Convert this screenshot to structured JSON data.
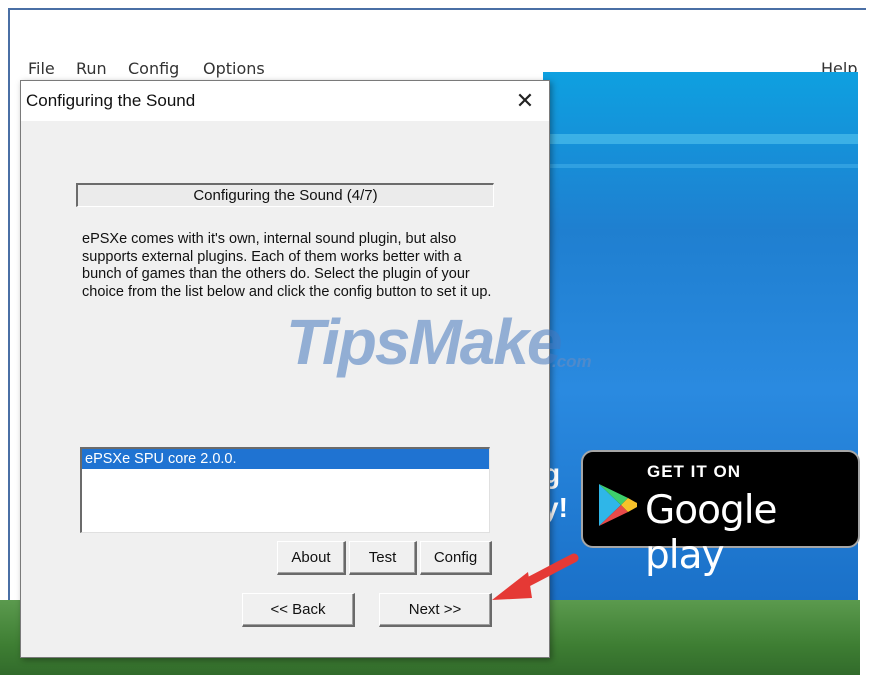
{
  "menubar": {
    "items": [
      "File",
      "Run",
      "Config",
      "Options"
    ],
    "help": "Help"
  },
  "background": {
    "partial_text_line1": "g",
    "partial_text_line2": "y!",
    "google_play": {
      "top": "GET IT ON",
      "main": "Google play"
    }
  },
  "dialog": {
    "title": "Configuring the Sound",
    "close": "✕",
    "step_header": "Configuring the Sound (4/7)",
    "description": "ePSXe comes with it's own, internal sound plugin, but also supports external plugins. Each of them works better with a bunch of games than the others do. Select the plugin of your choice from the list below and click the config button to set it up.",
    "plugins": [
      "ePSXe SPU core 2.0.0."
    ],
    "buttons": {
      "about": "About",
      "test": "Test",
      "config": "Config",
      "back": "<< Back",
      "next": "Next >>"
    }
  },
  "watermark": {
    "main": "TipsMake",
    "suffix": ".com"
  },
  "colors": {
    "selection": "#1f73d2",
    "annotation_arrow": "#e53935",
    "blue_background": "#1f7fd0"
  },
  "icons": {
    "close": "close-icon",
    "play_logo": "google-play-logo-icon",
    "annotation": "red-arrow-icon"
  }
}
